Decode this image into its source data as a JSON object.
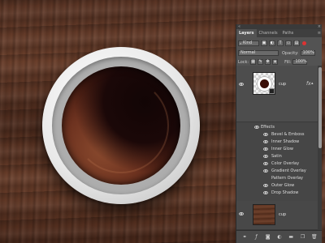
{
  "panel": {
    "tabs": [
      {
        "label": "Layers",
        "active": true
      },
      {
        "label": "Channels",
        "active": false
      },
      {
        "label": "Paths",
        "active": false
      }
    ],
    "filter": {
      "label": "Kind"
    },
    "blend_mode": "Normal",
    "opacity": {
      "label": "Opacity:",
      "value": "100%"
    },
    "lock": {
      "label": "Lock:"
    },
    "fill": {
      "label": "Fill:",
      "value": "100%"
    },
    "layers": [
      {
        "name": "cup",
        "has_fx": true,
        "fx_label": "fx"
      },
      {
        "name": "cup",
        "has_fx": false
      }
    ],
    "effects_header": "Effects",
    "effects": [
      "Bevel & Emboss",
      "Inner Shadow",
      "Inner Glow",
      "Satin",
      "Color Overlay",
      "Gradient Overlay",
      "Pattern Overlay",
      "Outer Glow",
      "Drop Shadow"
    ],
    "bottom_icons": [
      "link-icon",
      "fx-icon",
      "mask-icon",
      "adjustment-icon",
      "folder-icon",
      "new-layer-icon",
      "trash-icon"
    ],
    "colors": {
      "panel_bg": "#535353",
      "list_bg": "#464646"
    }
  }
}
